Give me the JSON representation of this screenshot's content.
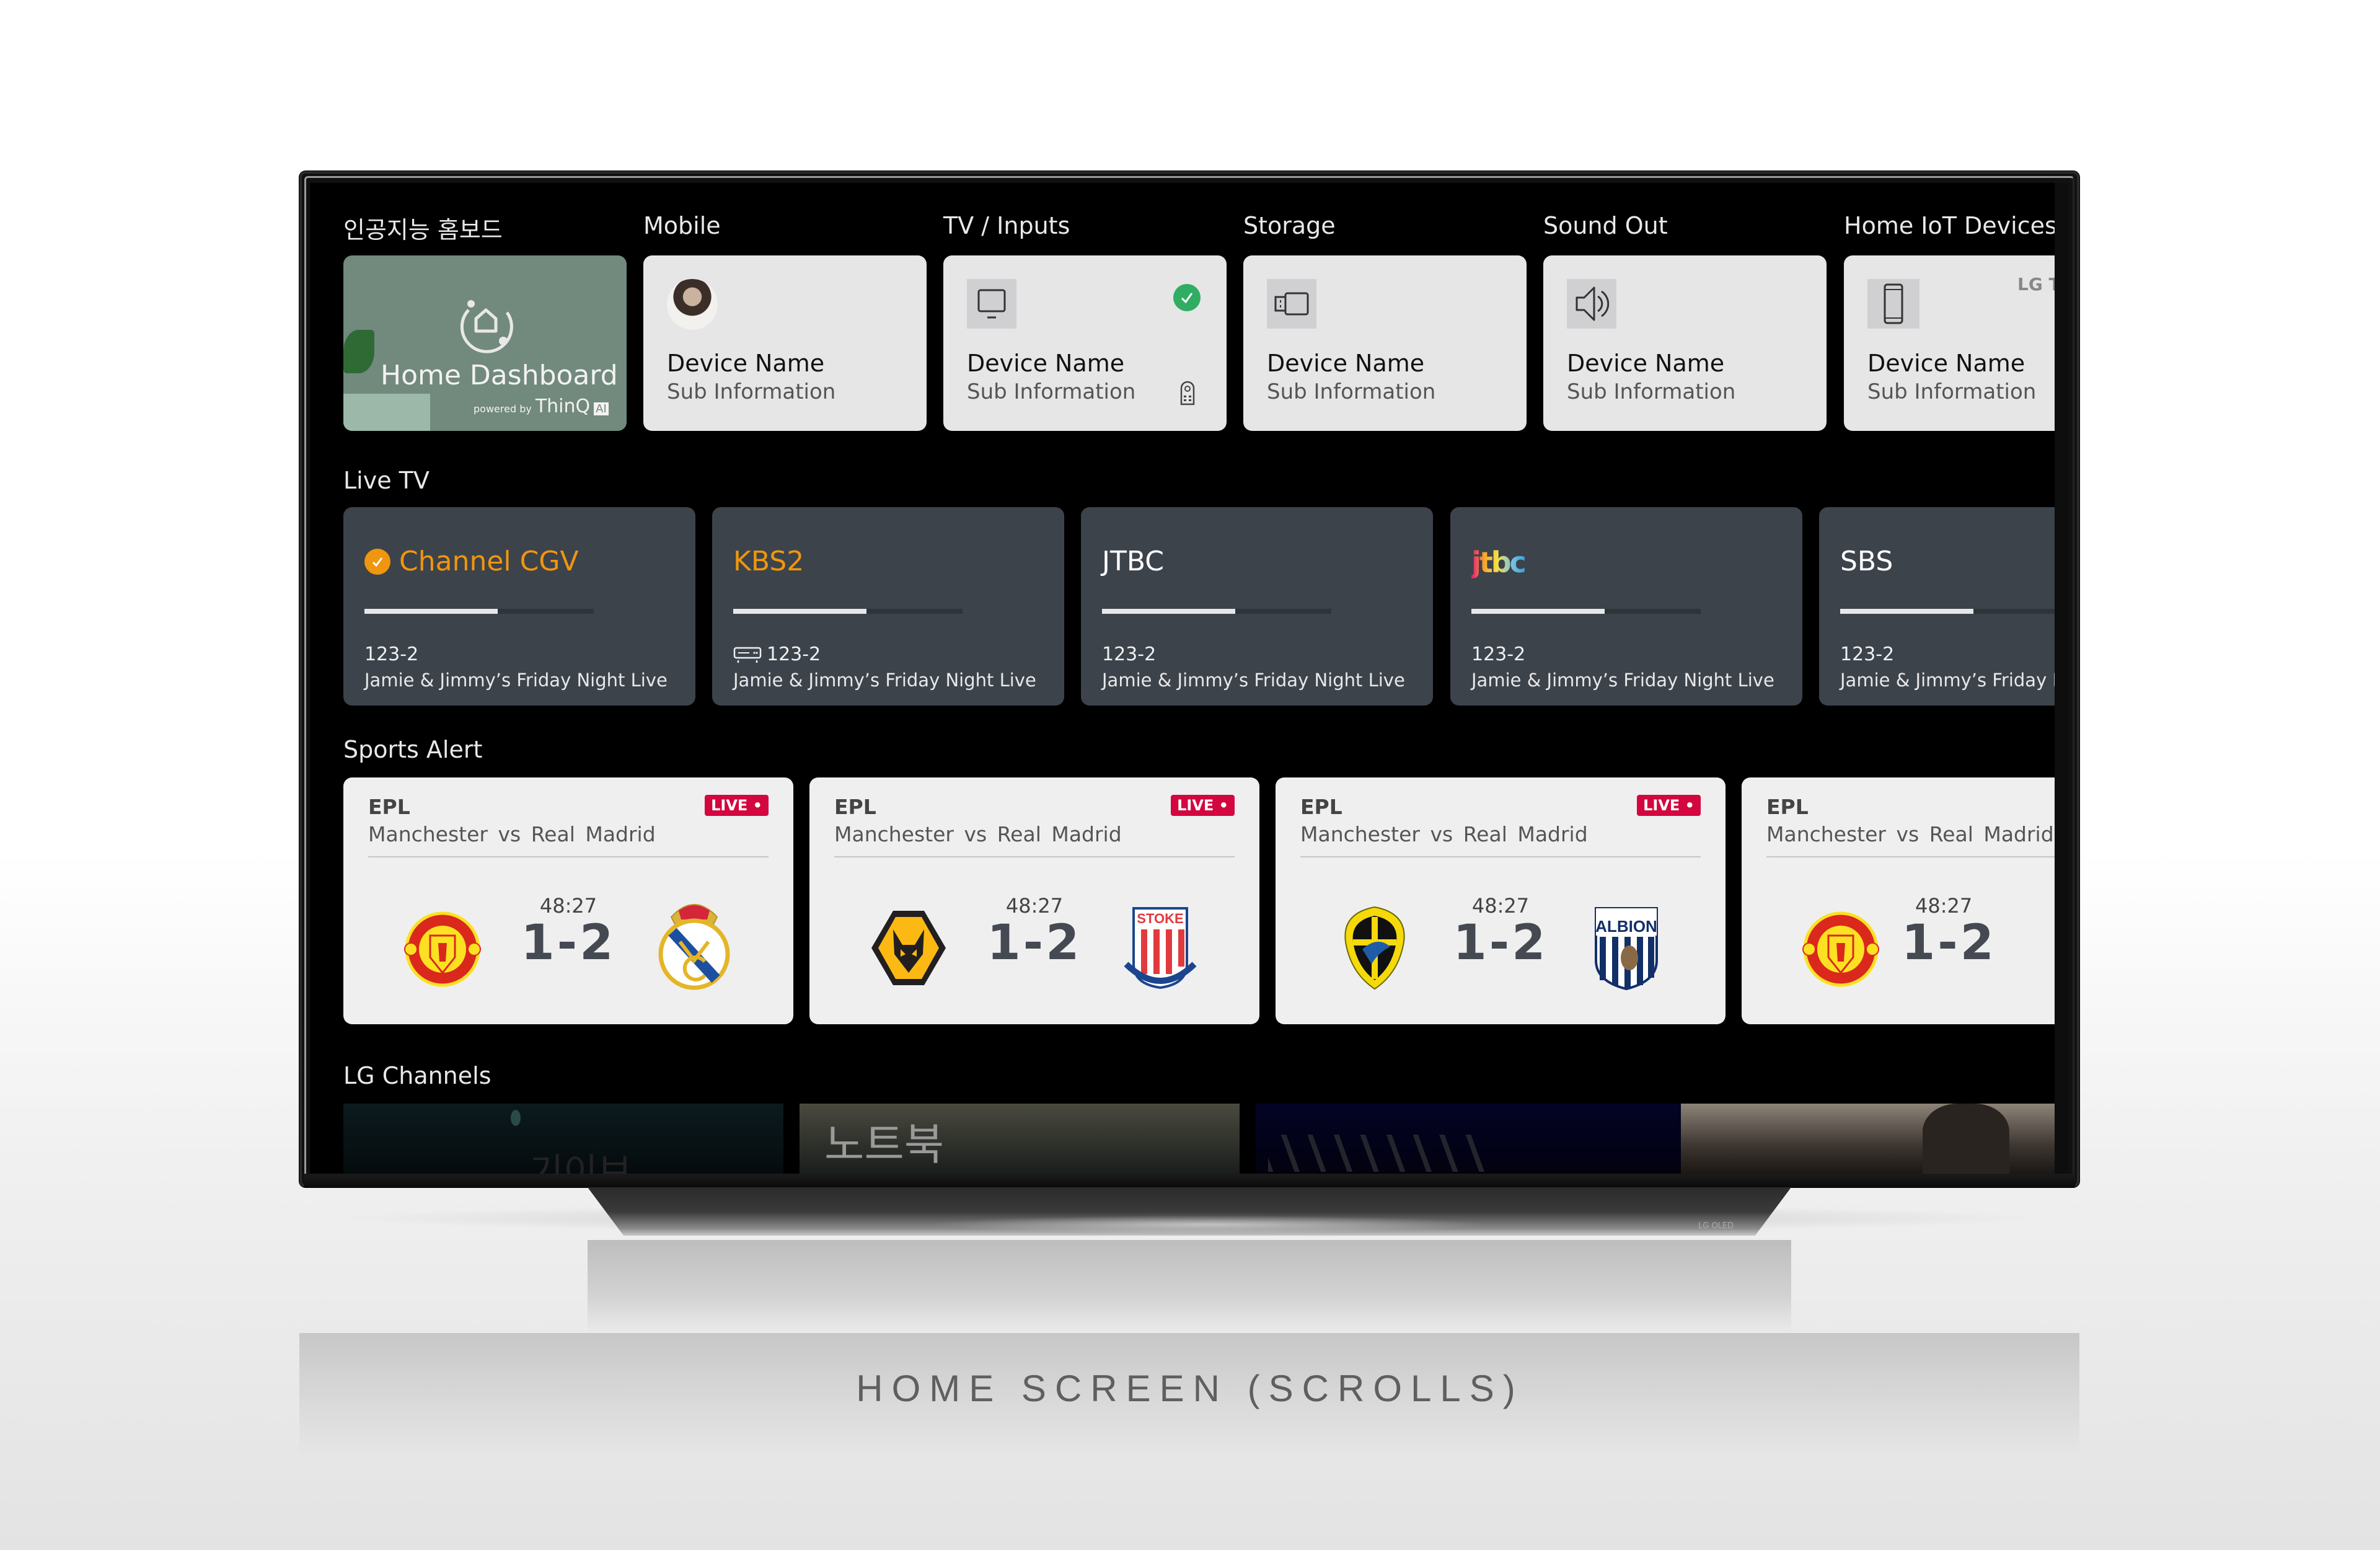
{
  "caption": "HOME SCREEN (SCROLLS)",
  "tv": {
    "stand_logo": "LG OLED"
  },
  "devices": {
    "sections": [
      {
        "label": "인공지능 홈보드"
      },
      {
        "label": "Mobile"
      },
      {
        "label": "TV / Inputs"
      },
      {
        "label": "Storage"
      },
      {
        "label": "Sound Out"
      },
      {
        "label": "Home IoT Devices"
      }
    ],
    "home_dashboard": {
      "title": "Home Dashboard",
      "powered_by": "powered by",
      "brand": "ThinQ",
      "brand_badge": "AI"
    },
    "cards": [
      {
        "name": "Device Name",
        "sub": "Sub Information",
        "icon": "avatar-photo"
      },
      {
        "name": "Device Name",
        "sub": "Sub Information",
        "icon": "tv-monitor-icon",
        "status": "connected-check",
        "extra_icon": "remote-control-icon"
      },
      {
        "name": "Device Name",
        "sub": "Sub Information",
        "icon": "usb-storage-icon"
      },
      {
        "name": "Device Name",
        "sub": "Sub Information",
        "icon": "speaker-icon"
      },
      {
        "name": "Device Name",
        "sub": "Sub Information",
        "icon": "smartphone-icon",
        "brand_tag": "LG Th"
      }
    ]
  },
  "live_tv": {
    "label": "Live TV",
    "channels": [
      {
        "name": "Channel CGV",
        "highlight": true,
        "checked": true,
        "number": "123-2",
        "program": "Jamie & Jimmy’s Friday Night Live",
        "progress": 0.58
      },
      {
        "name": "KBS2",
        "highlight": true,
        "set_top_box": true,
        "number": "123-2",
        "program": "Jamie & Jimmy’s Friday Night Live",
        "progress": 0.58
      },
      {
        "name": "JTBC",
        "number": "123-2",
        "program": "Jamie & Jimmy’s Friday Night Live",
        "progress": 0.58
      },
      {
        "name": "jtbc",
        "logo": true,
        "number": "123-2",
        "program": "Jamie & Jimmy’s Friday Night Live",
        "progress": 0.58
      },
      {
        "name": "SBS",
        "number": "123-2",
        "program": "Jamie & Jimmy’s Friday Night Live",
        "progress": 0.58
      }
    ]
  },
  "sports": {
    "label": "Sports Alert",
    "live_badge": "LIVE •",
    "games": [
      {
        "league": "EPL",
        "home": "Manchester",
        "vs": "vs",
        "away": "Real Madrid",
        "time": "48:27",
        "score": "1-2",
        "home_crest": "manchester-united-crest",
        "away_crest": "real-madrid-crest",
        "live": true
      },
      {
        "league": "EPL",
        "home": "Manchester",
        "vs": "vs",
        "away": "Real Madrid",
        "time": "48:27",
        "score": "1-2",
        "home_crest": "wolves-crest",
        "away_crest": "stoke-city-crest",
        "away_crest_text": "STOKE CITY",
        "live": true
      },
      {
        "league": "EPL",
        "home": "Manchester",
        "vs": "vs",
        "away": "Real Madrid",
        "time": "48:27",
        "score": "1-2",
        "home_crest": "cardiff-bluebirds-crest",
        "away_crest": "west-brom-crest",
        "away_crest_text": "ALBION",
        "live": true
      },
      {
        "league": "EPL",
        "home": "Manchester",
        "vs": "vs",
        "away": "Real Madrid",
        "time": "48:27",
        "score": "1-2",
        "home_crest": "manchester-united-crest",
        "away_crest": "real-madrid-crest",
        "live": false
      }
    ]
  },
  "lg_channels": {
    "label": "LG Channels",
    "thumbnails": [
      {
        "title_hint": "기이브",
        "tone": "#0a1518"
      },
      {
        "title_hint": "노트북",
        "tone": "#2c3430"
      },
      {
        "title_hint": "calligraphy",
        "tone": "#040418"
      },
      {
        "title_hint": "landscape",
        "tone": "#6b625a"
      }
    ]
  },
  "colors": {
    "accent_orange": "#f0960e",
    "live_red": "#d4063f",
    "check_green": "#2fae63",
    "card_dark": "#3d434b",
    "card_light": "#e6e6e6",
    "home_green": "#728a7d"
  }
}
